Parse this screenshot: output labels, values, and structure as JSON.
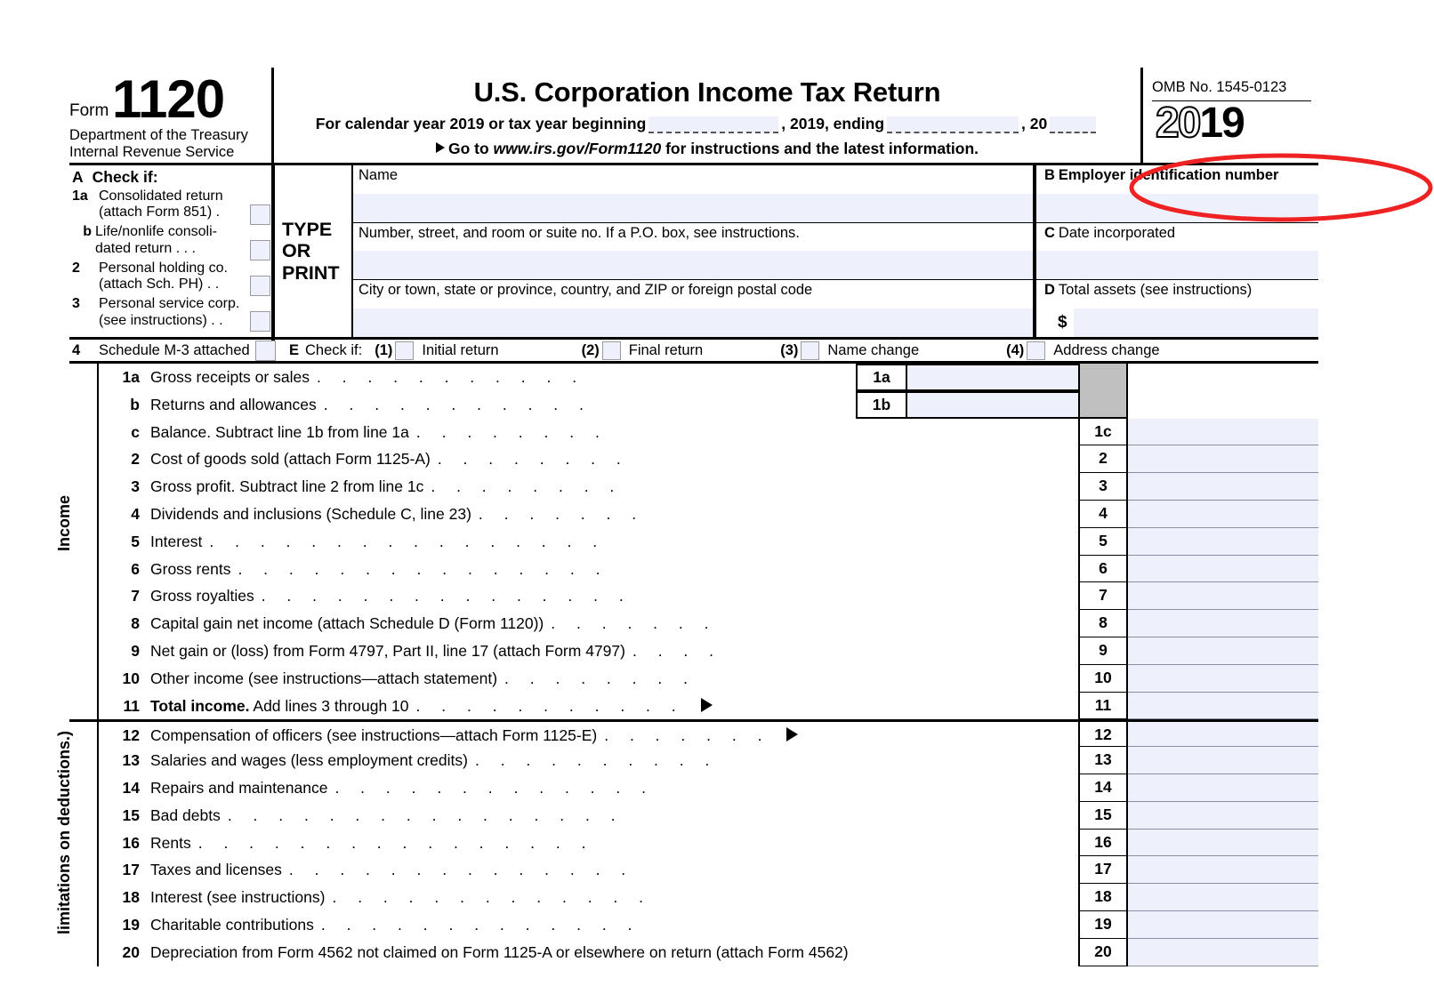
{
  "header": {
    "form_word": "Form",
    "form_number": "1120",
    "department_line1": "Department of the Treasury",
    "department_line2": "Internal Revenue Service",
    "title": "U.S. Corporation Income Tax Return",
    "calendar_prefix": "For calendar year 2019 or tax year beginning",
    "calendar_mid": ", 2019, ending",
    "calendar_suffix": ", 20",
    "goto_prefix": "Go to",
    "goto_url": "www.irs.gov/Form1120",
    "goto_suffix": "for instructions and the latest information.",
    "omb": "OMB No. 1545-0123",
    "year_hollow": "20",
    "year_solid": "19"
  },
  "section_a": {
    "title_letter": "A",
    "title": "Check if:",
    "items": [
      {
        "num": "1a",
        "line1": "Consolidated return",
        "line2": "(attach Form 851)",
        "dots": ".",
        "indent": false
      },
      {
        "num": "b",
        "line1": "Life/nonlife consoli-",
        "line2": "dated return .",
        "dots": ".    .",
        "indent": true
      },
      {
        "num": "2",
        "line1": "Personal holding co.",
        "line2": "(attach Sch. PH) .",
        "dots": ".",
        "indent": false
      },
      {
        "num": "3",
        "line1": "Personal service corp.",
        "line2": "(see instructions)",
        "dots": ".    .",
        "indent": false
      }
    ],
    "item4": {
      "num": "4",
      "label": "Schedule M-3 attached"
    }
  },
  "type_or_print": {
    "line1": "TYPE",
    "line2": "OR",
    "line3": "PRINT"
  },
  "address": {
    "name_label": "Name",
    "street_label": "Number, street, and room or suite no. If a P.O. box, see instructions.",
    "city_label": "City or town, state or province, country, and ZIP or foreign postal code"
  },
  "right_fields": {
    "b": {
      "letter": "B",
      "label": "Employer identification number"
    },
    "c": {
      "letter": "C",
      "label": "Date incorporated"
    },
    "d": {
      "letter": "D",
      "label": "Total assets (see instructions)",
      "currency": "$"
    }
  },
  "section_e": {
    "letter": "E",
    "label": "Check if:",
    "options": [
      {
        "num": "(1)",
        "label": "Initial return"
      },
      {
        "num": "(2)",
        "label": "Final return"
      },
      {
        "num": "(3)",
        "label": "Name change"
      },
      {
        "num": "(4)",
        "label": "Address change"
      }
    ]
  },
  "income_label": "Income",
  "deductions_label": "limitations on deductions.)",
  "lines": [
    {
      "num": "1a",
      "text": "Gross receipts or sales",
      "dots": 11,
      "mid": "1a",
      "rnum": "",
      "gray": "start"
    },
    {
      "num": "b",
      "text": "Returns and allowances",
      "dots": 11,
      "mid": "1b",
      "rnum": "",
      "gray": "end"
    },
    {
      "num": "c",
      "text": "Balance.  Subtract line 1b from line 1a",
      "dots": 8,
      "mid": "",
      "rnum": "1c"
    },
    {
      "num": "2",
      "text": "Cost of goods sold (attach Form 1125-A)",
      "dots": 8,
      "mid": "",
      "rnum": "2"
    },
    {
      "num": "3",
      "text": "Gross profit.  Subtract line 2 from line 1c",
      "dots": 8,
      "mid": "",
      "rnum": "3"
    },
    {
      "num": "4",
      "text": "Dividends and inclusions (Schedule C, line 23)",
      "dots": 7,
      "mid": "",
      "rnum": "4"
    },
    {
      "num": "5",
      "text": "Interest",
      "dots": 16,
      "mid": "",
      "rnum": "5"
    },
    {
      "num": "6",
      "text": "Gross rents",
      "dots": 15,
      "mid": "",
      "rnum": "6"
    },
    {
      "num": "7",
      "text": "Gross royalties",
      "dots": 15,
      "mid": "",
      "rnum": "7"
    },
    {
      "num": "8",
      "text": "Capital gain net income (attach Schedule D (Form 1120))",
      "dots": 7,
      "mid": "",
      "rnum": "8"
    },
    {
      "num": "9",
      "text": "Net gain or (loss) from Form 4797, Part II, line 17 (attach Form 4797)",
      "dots": 4,
      "mid": "",
      "rnum": "9"
    },
    {
      "num": "10",
      "text": "Other income (see instructions—attach statement)",
      "dots": 8,
      "mid": "",
      "rnum": "10"
    },
    {
      "num": "11",
      "text": "Total income.",
      "bold_prefix": "Total income.",
      "text_rest": "  Add lines 3 through 10",
      "dots": 11,
      "mid": "",
      "rnum": "11",
      "arrow": true
    },
    {
      "num": "12",
      "text": "Compensation of officers (see instructions—attach Form 1125-E)",
      "dots": 7,
      "mid": "",
      "rnum": "12",
      "arrow": true,
      "section_break": true
    },
    {
      "num": "13",
      "text": "Salaries and wages (less employment credits)",
      "dots": 10,
      "mid": "",
      "rnum": "13"
    },
    {
      "num": "14",
      "text": "Repairs and maintenance",
      "dots": 13,
      "mid": "",
      "rnum": "14"
    },
    {
      "num": "15",
      "text": "Bad debts",
      "dots": 16,
      "mid": "",
      "rnum": "15"
    },
    {
      "num": "16",
      "text": "Rents",
      "dots": 16,
      "mid": "",
      "rnum": "16"
    },
    {
      "num": "17",
      "text": "Taxes and licenses",
      "dots": 14,
      "mid": "",
      "rnum": "17"
    },
    {
      "num": "18",
      "text": "Interest (see instructions)",
      "dots": 13,
      "mid": "",
      "rnum": "18"
    },
    {
      "num": "19",
      "text": "Charitable contributions",
      "dots": 13,
      "mid": "",
      "rnum": "19"
    },
    {
      "num": "20",
      "text": "Depreciation from Form 4562 not claimed on Form 1125-A or elsewhere on return (attach Form 4562)",
      "dots": 3,
      "mid": "",
      "rnum": "20"
    }
  ],
  "annotation": {
    "shape": "ellipse",
    "color": "#ee2222",
    "targets": "Employer identification number"
  },
  "colors": {
    "field_fill": "#eef0fb",
    "gray_block": "#c0c0c0",
    "annotation_red": "#ee2222"
  }
}
